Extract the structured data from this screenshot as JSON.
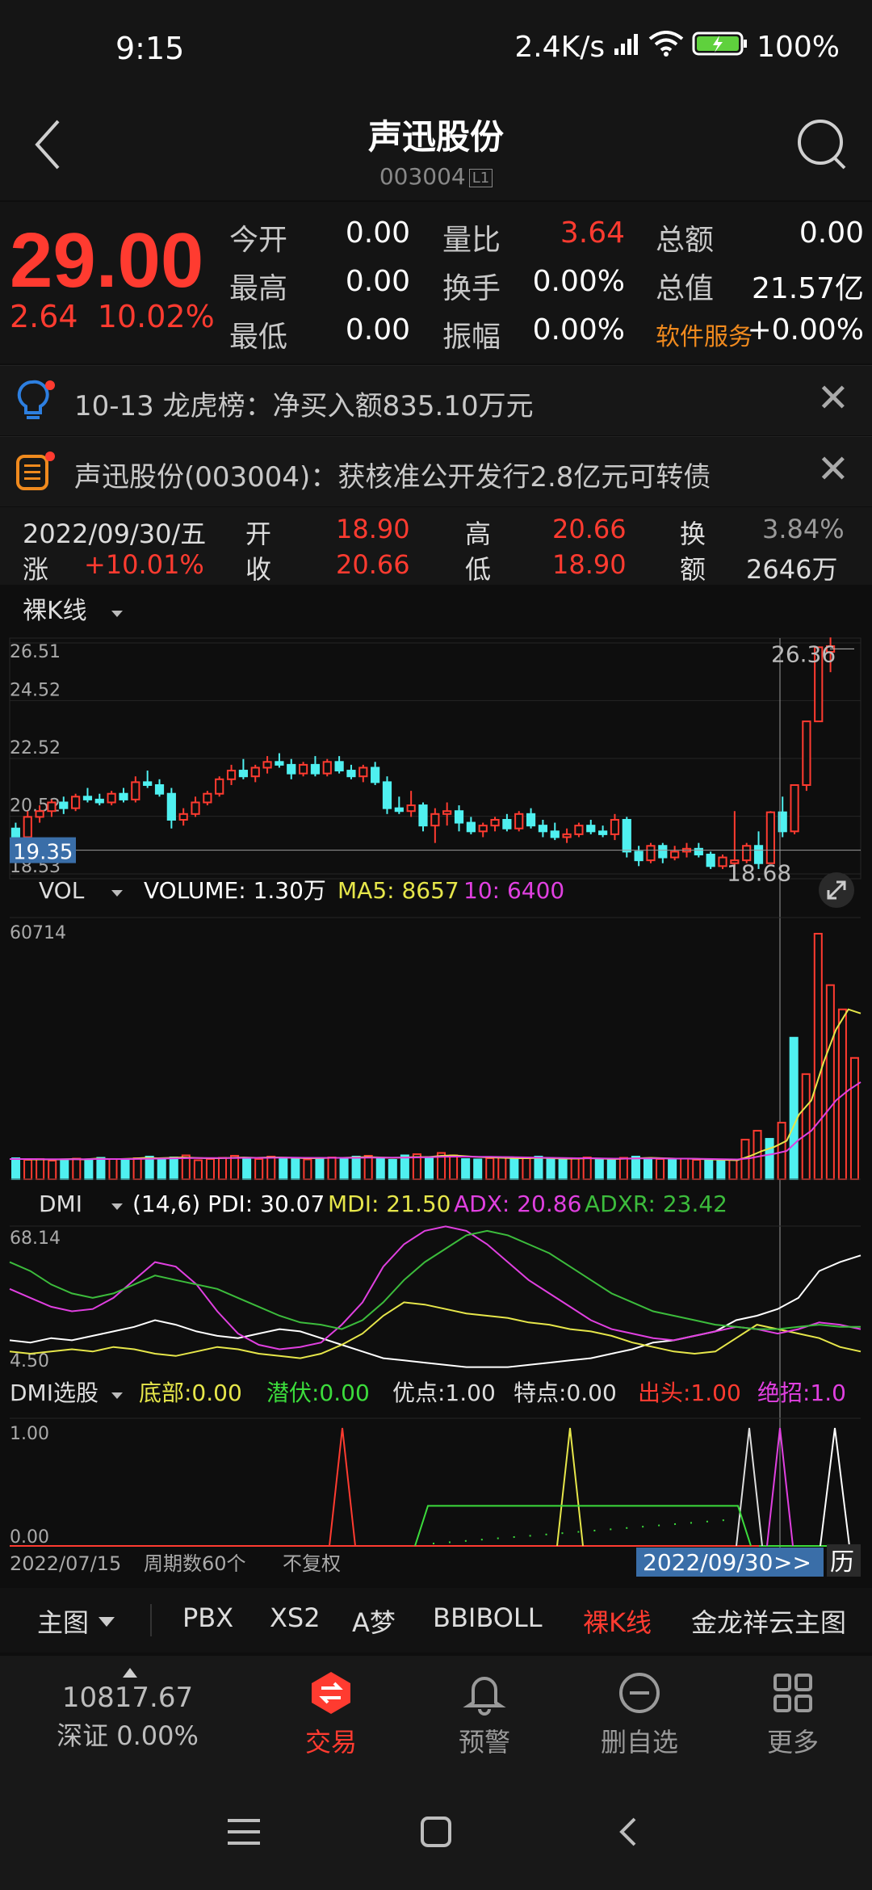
{
  "status_bar": {
    "time": "9:15",
    "network_speed": "2.4K/s",
    "battery": "100%"
  },
  "header": {
    "title": "声迅股份",
    "code": "003004",
    "level_badge": "L1"
  },
  "quote": {
    "price": "29.00",
    "change": "2.64",
    "change_pct": "10.02%",
    "fields": [
      {
        "label": "今开",
        "value": "0.00"
      },
      {
        "label": "量比",
        "value": "3.64",
        "value_red": true
      },
      {
        "label": "总额",
        "value": "0.00"
      },
      {
        "label": "最高",
        "value": "0.00"
      },
      {
        "label": "换手",
        "value": "0.00%"
      },
      {
        "label": "总值",
        "value": "21.57亿"
      },
      {
        "label": "最低",
        "value": "0.00"
      },
      {
        "label": "振幅",
        "value": "0.00%"
      },
      {
        "label": "软件服务",
        "value": "+0.00%",
        "label_orange": true
      }
    ]
  },
  "notices": [
    {
      "text": "10-13 龙虎榜：净买入额835.10万元"
    },
    {
      "text": "声迅股份(003004)：获核准公开发行2.8亿元可转债"
    }
  ],
  "kline_info": {
    "date": "2022/09/30/五",
    "open_label": "开",
    "open": "18.90",
    "high_label": "高",
    "high": "20.66",
    "turnover_label": "换",
    "turnover": "3.84%",
    "rise_label": "涨",
    "rise": "+10.01%",
    "close_label": "收",
    "close": "20.66",
    "low_label": "低",
    "low": "18.90",
    "amount_label": "额",
    "amount": "2646万"
  },
  "chart_type_selector": "裸K线",
  "chart_data": [
    {
      "type": "candlestick",
      "ylim": [
        18.53,
        26.51
      ],
      "y_ticks": [
        "26.51",
        "24.52",
        "22.52",
        "20.52",
        "18.53"
      ],
      "crosshair_price": "19.35",
      "max_label": "26.36",
      "min_label": "18.68",
      "candles": [
        {
          "o": 20.1,
          "h": 20.3,
          "l": 19.7,
          "c": 19.8
        },
        {
          "o": 19.8,
          "h": 20.7,
          "l": 19.7,
          "c": 20.5
        },
        {
          "o": 20.5,
          "h": 20.9,
          "l": 20.3,
          "c": 20.7
        },
        {
          "o": 20.7,
          "h": 21.1,
          "l": 20.5,
          "c": 21.0
        },
        {
          "o": 21.0,
          "h": 21.2,
          "l": 20.6,
          "c": 20.8
        },
        {
          "o": 20.8,
          "h": 21.3,
          "l": 20.7,
          "c": 21.2
        },
        {
          "o": 21.2,
          "h": 21.5,
          "l": 21.0,
          "c": 21.1
        },
        {
          "o": 21.1,
          "h": 21.3,
          "l": 20.9,
          "c": 21.0
        },
        {
          "o": 21.0,
          "h": 21.4,
          "l": 20.9,
          "c": 21.3
        },
        {
          "o": 21.3,
          "h": 21.5,
          "l": 21.0,
          "c": 21.1
        },
        {
          "o": 21.1,
          "h": 21.9,
          "l": 21.0,
          "c": 21.7
        },
        {
          "o": 21.7,
          "h": 22.1,
          "l": 21.5,
          "c": 21.6
        },
        {
          "o": 21.6,
          "h": 21.8,
          "l": 21.2,
          "c": 21.3
        },
        {
          "o": 21.3,
          "h": 21.5,
          "l": 20.1,
          "c": 20.4
        },
        {
          "o": 20.4,
          "h": 20.8,
          "l": 20.2,
          "c": 20.6
        },
        {
          "o": 20.6,
          "h": 21.2,
          "l": 20.5,
          "c": 21.0
        },
        {
          "o": 21.0,
          "h": 21.4,
          "l": 20.9,
          "c": 21.3
        },
        {
          "o": 21.3,
          "h": 21.9,
          "l": 21.2,
          "c": 21.8
        },
        {
          "o": 21.8,
          "h": 22.3,
          "l": 21.6,
          "c": 22.1
        },
        {
          "o": 22.1,
          "h": 22.5,
          "l": 21.8,
          "c": 21.9
        },
        {
          "o": 21.9,
          "h": 22.3,
          "l": 21.7,
          "c": 22.2
        },
        {
          "o": 22.2,
          "h": 22.6,
          "l": 22.0,
          "c": 22.4
        },
        {
          "o": 22.4,
          "h": 22.7,
          "l": 22.2,
          "c": 22.3
        },
        {
          "o": 22.3,
          "h": 22.5,
          "l": 21.8,
          "c": 22.0
        },
        {
          "o": 22.0,
          "h": 22.4,
          "l": 21.9,
          "c": 22.3
        },
        {
          "o": 22.3,
          "h": 22.6,
          "l": 21.9,
          "c": 22.0
        },
        {
          "o": 22.0,
          "h": 22.5,
          "l": 21.9,
          "c": 22.4
        },
        {
          "o": 22.4,
          "h": 22.6,
          "l": 22.0,
          "c": 22.1
        },
        {
          "o": 22.1,
          "h": 22.3,
          "l": 21.8,
          "c": 21.9
        },
        {
          "o": 21.9,
          "h": 22.3,
          "l": 21.7,
          "c": 22.2
        },
        {
          "o": 22.2,
          "h": 22.4,
          "l": 21.6,
          "c": 21.7
        },
        {
          "o": 21.7,
          "h": 21.9,
          "l": 20.6,
          "c": 20.8
        },
        {
          "o": 20.8,
          "h": 21.2,
          "l": 20.6,
          "c": 20.7
        },
        {
          "o": 20.7,
          "h": 21.4,
          "l": 20.5,
          "c": 20.9
        },
        {
          "o": 20.9,
          "h": 21.0,
          "l": 20.0,
          "c": 20.2
        },
        {
          "o": 20.2,
          "h": 20.8,
          "l": 19.6,
          "c": 20.6
        },
        {
          "o": 20.6,
          "h": 21.0,
          "l": 20.2,
          "c": 20.7
        },
        {
          "o": 20.7,
          "h": 20.9,
          "l": 20.0,
          "c": 20.3
        },
        {
          "o": 20.3,
          "h": 20.5,
          "l": 19.9,
          "c": 20.0
        },
        {
          "o": 20.0,
          "h": 20.3,
          "l": 19.8,
          "c": 20.2
        },
        {
          "o": 20.2,
          "h": 20.5,
          "l": 20.0,
          "c": 20.4
        },
        {
          "o": 20.4,
          "h": 20.6,
          "l": 20.0,
          "c": 20.1
        },
        {
          "o": 20.1,
          "h": 20.7,
          "l": 20.0,
          "c": 20.6
        },
        {
          "o": 20.6,
          "h": 20.8,
          "l": 20.1,
          "c": 20.2
        },
        {
          "o": 20.2,
          "h": 20.4,
          "l": 19.8,
          "c": 20.0
        },
        {
          "o": 20.0,
          "h": 20.3,
          "l": 19.7,
          "c": 19.8
        },
        {
          "o": 19.8,
          "h": 20.1,
          "l": 19.6,
          "c": 19.9
        },
        {
          "o": 19.9,
          "h": 20.3,
          "l": 19.8,
          "c": 20.2
        },
        {
          "o": 20.2,
          "h": 20.4,
          "l": 19.9,
          "c": 20.0
        },
        {
          "o": 20.0,
          "h": 20.2,
          "l": 19.8,
          "c": 19.9
        },
        {
          "o": 19.9,
          "h": 20.6,
          "l": 19.7,
          "c": 20.4
        },
        {
          "o": 20.4,
          "h": 20.5,
          "l": 19.1,
          "c": 19.3
        },
        {
          "o": 19.3,
          "h": 19.5,
          "l": 18.8,
          "c": 19.0
        },
        {
          "o": 19.0,
          "h": 19.6,
          "l": 18.9,
          "c": 19.5
        },
        {
          "o": 19.5,
          "h": 19.6,
          "l": 18.9,
          "c": 19.1
        },
        {
          "o": 19.1,
          "h": 19.5,
          "l": 19.0,
          "c": 19.3
        },
        {
          "o": 19.3,
          "h": 19.6,
          "l": 19.1,
          "c": 19.4
        },
        {
          "o": 19.4,
          "h": 19.6,
          "l": 19.1,
          "c": 19.2
        },
        {
          "o": 19.2,
          "h": 19.3,
          "l": 18.7,
          "c": 18.8
        },
        {
          "o": 18.8,
          "h": 19.2,
          "l": 18.7,
          "c": 19.1
        },
        {
          "o": 18.9,
          "h": 20.7,
          "l": 18.8,
          "c": 19.0
        },
        {
          "o": 19.0,
          "h": 19.6,
          "l": 18.9,
          "c": 19.5
        },
        {
          "o": 19.5,
          "h": 20.0,
          "l": 18.7,
          "c": 18.9
        },
        {
          "o": 18.9,
          "h": 20.7,
          "l": 18.9,
          "c": 20.66
        },
        {
          "o": 20.66,
          "h": 21.2,
          "l": 19.8,
          "c": 20.0
        },
        {
          "o": 20.0,
          "h": 21.6,
          "l": 19.9,
          "c": 21.6
        },
        {
          "o": 21.6,
          "h": 23.8,
          "l": 21.4,
          "c": 23.8
        },
        {
          "o": 23.8,
          "h": 26.36,
          "l": 23.8,
          "c": 26.36
        },
        {
          "o": 26.2,
          "h": 26.7,
          "l": 25.5,
          "c": 26.4
        }
      ]
    },
    {
      "type": "bar",
      "title": "VOL",
      "legend": {
        "volume_label": "VOLUME:",
        "volume": "1.30万",
        "ma5_label": "MA5:",
        "ma5": "8657",
        "ma10_label": "10:",
        "ma10": "6400"
      },
      "y_ticks": [
        "60714"
      ],
      "ylim": [
        0,
        60714
      ],
      "values": [
        5200,
        4800,
        5000,
        4600,
        4900,
        5100,
        4700,
        5300,
        5000,
        4800,
        5200,
        5600,
        5100,
        5400,
        5900,
        4700,
        5000,
        5300,
        5800,
        5200,
        5000,
        5600,
        5300,
        5000,
        4900,
        5100,
        5400,
        5200,
        5600,
        5800,
        5000,
        4800,
        5900,
        6200,
        5500,
        6500,
        5900,
        5000,
        4900,
        5200,
        5400,
        5100,
        5300,
        5600,
        5000,
        4800,
        5100,
        5400,
        5000,
        4900,
        5300,
        5600,
        5200,
        5000,
        4900,
        5100,
        4800,
        4700,
        4600,
        4800,
        9800,
        12000,
        10000,
        14000,
        35000,
        26000,
        60714,
        48000,
        42000,
        30000
      ],
      "ma5_values": [
        5000,
        5000,
        4900,
        4900,
        4900,
        5000,
        4900,
        5100,
        5000,
        5000,
        5100,
        5300,
        5200,
        5300,
        5400,
        5300,
        5200,
        5200,
        5300,
        5400,
        5300,
        5400,
        5400,
        5300,
        5200,
        5200,
        5300,
        5300,
        5400,
        5500,
        5400,
        5300,
        5400,
        5500,
        5500,
        5800,
        5900,
        5700,
        5500,
        5400,
        5300,
        5200,
        5200,
        5300,
        5200,
        5100,
        5100,
        5200,
        5100,
        5000,
        5100,
        5200,
        5300,
        5200,
        5100,
        5100,
        5000,
        4900,
        4800,
        4700,
        5700,
        7000,
        8000,
        9500,
        16000,
        19500,
        29000,
        37000,
        42000,
        41000
      ],
      "ma10_values": [
        5000,
        5000,
        5000,
        4950,
        4950,
        4950,
        4950,
        5000,
        5000,
        5000,
        5000,
        5050,
        5100,
        5150,
        5200,
        5250,
        5250,
        5250,
        5250,
        5300,
        5300,
        5300,
        5350,
        5350,
        5300,
        5300,
        5300,
        5300,
        5300,
        5350,
        5350,
        5350,
        5350,
        5400,
        5450,
        5550,
        5600,
        5600,
        5550,
        5550,
        5500,
        5450,
        5400,
        5350,
        5300,
        5250,
        5200,
        5200,
        5150,
        5100,
        5100,
        5150,
        5150,
        5150,
        5100,
        5100,
        5050,
        5000,
        4950,
        4900,
        5200,
        5800,
        6300,
        7000,
        9800,
        12000,
        15700,
        19500,
        22000,
        24000
      ]
    },
    {
      "type": "line",
      "title": "DMI",
      "legend": {
        "params": "(14,6)",
        "pdi_label": "PDI:",
        "pdi": "30.07",
        "mdi_label": "MDI:",
        "mdi": "21.50",
        "adx_label": "ADX:",
        "adx": "20.86",
        "adxr_label": "ADXR:",
        "adxr": "23.42"
      },
      "y_ticks": [
        "68.14",
        "4.50"
      ],
      "ylim": [
        4.5,
        68.14
      ],
      "series": [
        {
          "name": "PDI",
          "color": "#ffffff",
          "values": [
            17,
            16,
            18,
            17,
            19,
            21,
            23,
            26,
            24,
            21,
            19,
            18,
            20,
            22,
            21,
            18,
            15,
            12,
            9,
            8,
            7,
            6,
            5,
            5,
            5,
            6,
            7,
            8,
            9,
            11,
            13,
            16,
            17,
            19,
            21,
            26,
            28,
            31,
            36,
            48,
            52,
            55
          ]
        },
        {
          "name": "MDI",
          "color": "#e6e64a",
          "values": [
            12,
            11,
            12,
            13,
            12,
            14,
            13,
            11,
            10,
            12,
            14,
            13,
            11,
            10,
            9,
            11,
            15,
            20,
            28,
            34,
            33,
            31,
            29,
            28,
            27,
            25,
            24,
            22,
            21,
            19,
            16,
            14,
            12,
            11,
            12,
            18,
            24,
            22,
            20,
            18,
            14,
            12
          ]
        },
        {
          "name": "ADX",
          "color": "#e040e0",
          "values": [
            40,
            36,
            32,
            30,
            31,
            36,
            44,
            52,
            50,
            42,
            30,
            20,
            15,
            13,
            14,
            16,
            24,
            34,
            50,
            60,
            66,
            68,
            66,
            60,
            52,
            44,
            38,
            32,
            26,
            22,
            20,
            18,
            17,
            19,
            21,
            23,
            22,
            20,
            22,
            25,
            24,
            22
          ]
        },
        {
          "name": "ADXR",
          "color": "#3cbc3c",
          "values": [
            52,
            48,
            42,
            38,
            36,
            38,
            42,
            46,
            44,
            42,
            40,
            36,
            32,
            28,
            25,
            24,
            22,
            26,
            34,
            44,
            52,
            58,
            64,
            66,
            64,
            60,
            56,
            50,
            44,
            38,
            34,
            30,
            28,
            26,
            24,
            23,
            22,
            22,
            23,
            24,
            23,
            23
          ]
        }
      ]
    },
    {
      "type": "line",
      "title": "DMI选股",
      "legend": [
        {
          "label": "底部:",
          "value": "0.00",
          "color": "#e6e64a"
        },
        {
          "label": "潜伏:",
          "value": "0.00",
          "color": "#3cdc3c"
        },
        {
          "label": "优点:",
          "value": "1.00",
          "color": "#dddddd"
        },
        {
          "label": "特点:",
          "value": "0.00",
          "color": "#dddddd"
        },
        {
          "label": "出头:",
          "value": "1.00",
          "color": "#ff3b30"
        },
        {
          "label": "绝招:",
          "value": "1.0",
          "color": "#e040e0"
        }
      ],
      "y_ticks": [
        "1.00",
        "0.00"
      ],
      "ylim": [
        0,
        1
      ],
      "x_start_label": "2022/07/15",
      "period_label": "周期数60个",
      "adjust_label": "不复权",
      "x_end_label": "2022/09/30",
      "nav_label": ">>",
      "history_label": "历"
    }
  ],
  "bottom_tabs": [
    "主图",
    "PBX",
    "XS2",
    "A梦",
    "BBIBOLL",
    "裸K线",
    "金龙祥云主图"
  ],
  "active_tab": "裸K线",
  "footer": {
    "index_value": "10817.67",
    "index_name": "深证",
    "index_change": "0.00%",
    "nav": [
      {
        "label": "交易"
      },
      {
        "label": "预警"
      },
      {
        "label": "删自选"
      },
      {
        "label": "更多"
      }
    ]
  },
  "colors": {
    "up": "#ff3b30",
    "down": "#4ff0f0",
    "bg": "#0e0e0e",
    "accent": "#ff3b30"
  }
}
